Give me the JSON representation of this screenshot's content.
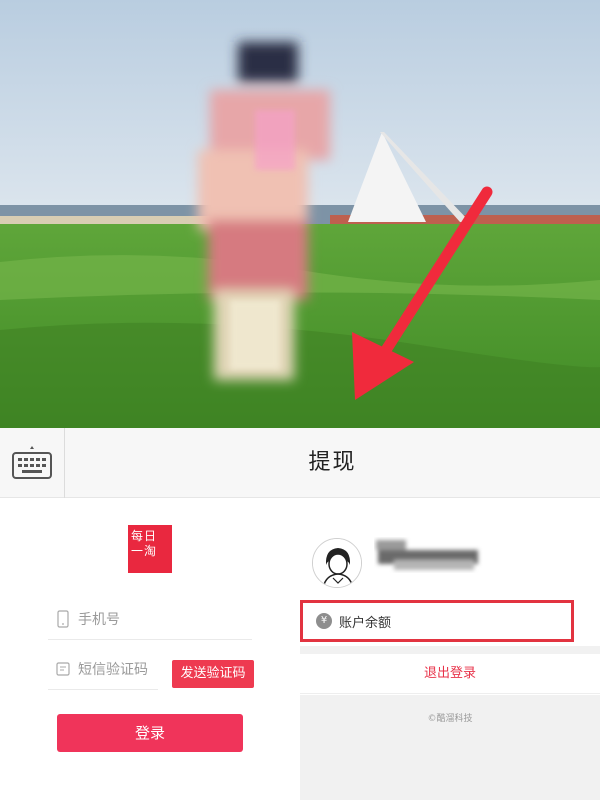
{
  "header": {
    "title": "提现",
    "keyboard_icon": "keyboard-icon"
  },
  "login": {
    "logo_lines": [
      "每日",
      "一淘"
    ],
    "phone_placeholder": "手机号",
    "code_placeholder": "短信验证码",
    "send_code_label": "发送验证码",
    "login_label": "登录"
  },
  "account": {
    "avatar_icon": "user-avatar-icon",
    "balance_icon_glyph": "¥",
    "balance_label": "账户余额",
    "logout_label": "退出登录",
    "copyright": "©酷溜科技"
  },
  "colors": {
    "accent": "#f0345a",
    "highlight_box": "#e23340",
    "arrow": "#f02a3c"
  }
}
